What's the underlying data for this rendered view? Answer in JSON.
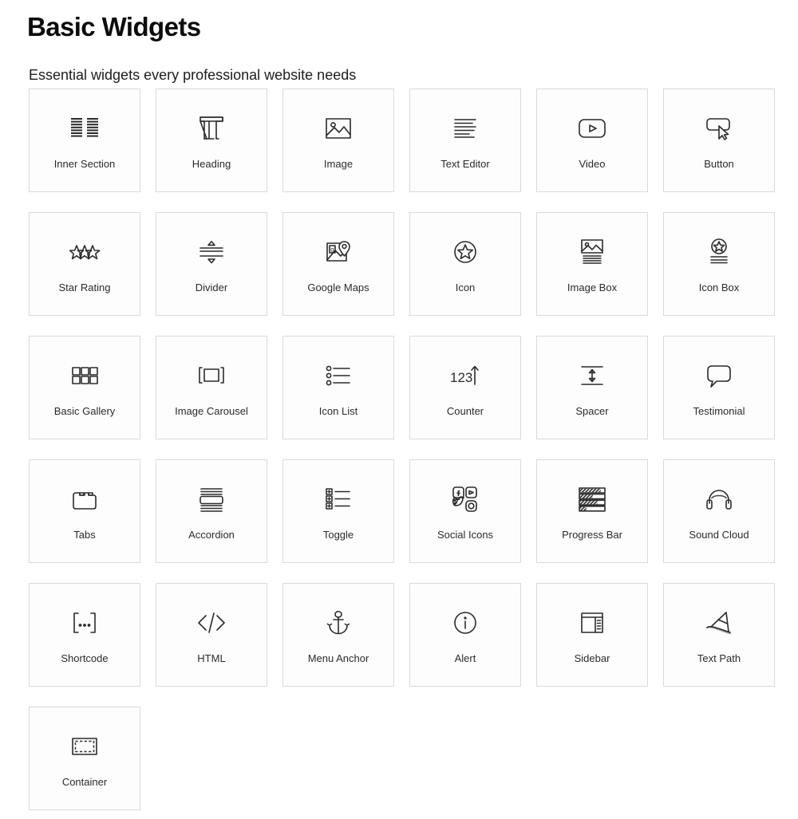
{
  "header": {
    "title": "Basic Widgets",
    "subtitle": "Essential widgets every professional website needs"
  },
  "theme": {
    "page_background": "#ffffff",
    "card_background": "#fdfdfd",
    "card_border": "#dadada",
    "title_color": "#0c0c0c",
    "label_color": "#2b2b2b",
    "icon_stroke": "#2b2b2b"
  },
  "grid": {
    "columns": 6,
    "total_widgets": 31
  },
  "widgets": [
    {
      "label": "Inner Section",
      "icon": "inner-section-icon"
    },
    {
      "label": "Heading",
      "icon": "heading-icon"
    },
    {
      "label": "Image",
      "icon": "image-icon"
    },
    {
      "label": "Text Editor",
      "icon": "text-editor-icon"
    },
    {
      "label": "Video",
      "icon": "video-icon"
    },
    {
      "label": "Button",
      "icon": "button-icon"
    },
    {
      "label": "Star Rating",
      "icon": "star-rating-icon"
    },
    {
      "label": "Divider",
      "icon": "divider-icon"
    },
    {
      "label": "Google Maps",
      "icon": "google-maps-icon"
    },
    {
      "label": "Icon",
      "icon": "icon-icon"
    },
    {
      "label": "Image Box",
      "icon": "image-box-icon"
    },
    {
      "label": "Icon Box",
      "icon": "icon-box-icon"
    },
    {
      "label": "Basic Gallery",
      "icon": "basic-gallery-icon"
    },
    {
      "label": "Image Carousel",
      "icon": "image-carousel-icon"
    },
    {
      "label": "Icon List",
      "icon": "icon-list-icon"
    },
    {
      "label": "Counter",
      "icon": "counter-icon"
    },
    {
      "label": "Spacer",
      "icon": "spacer-icon"
    },
    {
      "label": "Testimonial",
      "icon": "testimonial-icon"
    },
    {
      "label": "Tabs",
      "icon": "tabs-icon"
    },
    {
      "label": "Accordion",
      "icon": "accordion-icon"
    },
    {
      "label": "Toggle",
      "icon": "toggle-icon"
    },
    {
      "label": "Social Icons",
      "icon": "social-icons-icon"
    },
    {
      "label": "Progress Bar",
      "icon": "progress-bar-icon"
    },
    {
      "label": "Sound Cloud",
      "icon": "sound-cloud-icon"
    },
    {
      "label": "Shortcode",
      "icon": "shortcode-icon"
    },
    {
      "label": "HTML",
      "icon": "html-icon"
    },
    {
      "label": "Menu Anchor",
      "icon": "menu-anchor-icon"
    },
    {
      "label": "Alert",
      "icon": "alert-icon"
    },
    {
      "label": "Sidebar",
      "icon": "sidebar-icon"
    },
    {
      "label": "Text Path",
      "icon": "text-path-icon"
    },
    {
      "label": "Container",
      "icon": "container-icon"
    }
  ],
  "icon_glyph_text": {
    "counter": "123",
    "shortcode": "[...]",
    "html": "</>",
    "google_maps_letter": "g",
    "heading_letter": "T",
    "facebook_letter": "f",
    "alert_letter": "i"
  }
}
